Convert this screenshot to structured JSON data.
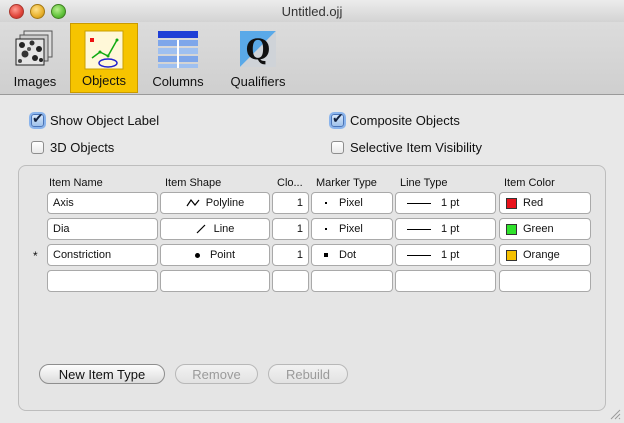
{
  "window": {
    "title": "Untitled.ojj"
  },
  "toolbar": {
    "buttons": [
      {
        "label": "Images",
        "icon": "images-icon",
        "selected": false
      },
      {
        "label": "Objects",
        "icon": "objects-icon",
        "selected": true
      },
      {
        "label": "Columns",
        "icon": "columns-icon",
        "selected": false
      },
      {
        "label": "Qualifiers",
        "icon": "qualifiers-icon",
        "selected": false
      }
    ]
  },
  "options": {
    "show_object_label": {
      "label": "Show Object Label",
      "checked": true
    },
    "composite_objects": {
      "label": "Composite Objects",
      "checked": true
    },
    "objects_3d": {
      "label": "3D Objects",
      "checked": false
    },
    "selective_visibility": {
      "label": "Selective Item Visibility",
      "checked": false
    }
  },
  "table": {
    "headers": [
      "Item Name",
      "Item Shape",
      "Clo...",
      "Marker Type",
      "Line Type",
      "Item Color"
    ],
    "rows": [
      {
        "marker": "",
        "name": "Axis",
        "shape": "Polyline",
        "shape_icon": "polyline-icon",
        "count": "1",
        "marker_type": "Pixel",
        "line_type": "1 pt",
        "color_name": "Red",
        "color": "#e8121b"
      },
      {
        "marker": "",
        "name": "Dia",
        "shape": "Line",
        "shape_icon": "line-icon",
        "count": "1",
        "marker_type": "Pixel",
        "line_type": "1 pt",
        "color_name": "Green",
        "color": "#2fe22c"
      },
      {
        "marker": "*",
        "name": "Constriction",
        "shape": "Point",
        "shape_icon": "point-icon",
        "count": "1",
        "marker_type": "Dot",
        "line_type": "1 pt",
        "color_name": "Orange",
        "color": "#f5c000"
      }
    ]
  },
  "buttons": {
    "new_item_type": "New Item Type",
    "remove": "Remove",
    "rebuild": "Rebuild"
  }
}
